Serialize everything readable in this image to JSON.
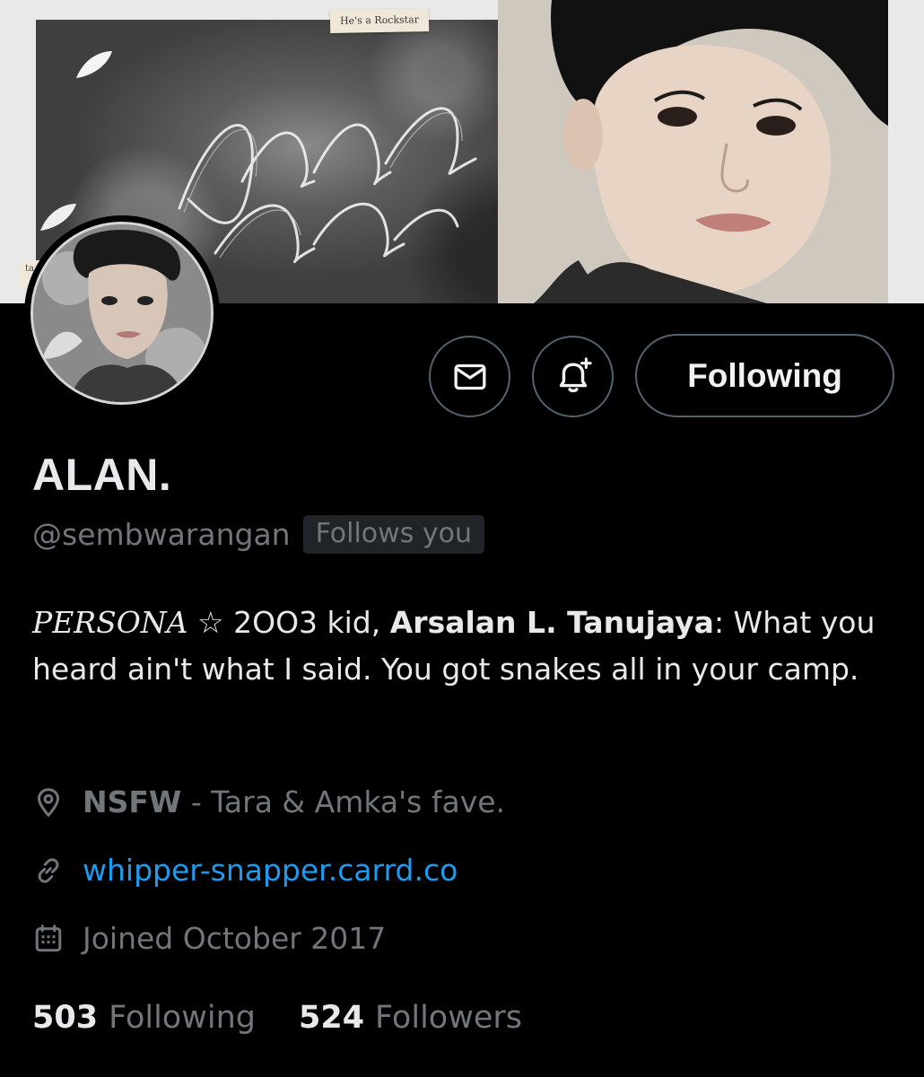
{
  "banner": {
    "tag_label": "He's a Rockstar",
    "side_tag": "ta"
  },
  "actions": {
    "message_icon": "envelope-icon",
    "notify_icon": "bell-plus-icon",
    "following_label": "Following"
  },
  "profile": {
    "display_name": "ALAN.",
    "handle": "@sembwarangan",
    "follows_you": "Follows you"
  },
  "bio": {
    "persona": "PERSONA",
    "star": "☆",
    "part1": " 2OO3 kid, ",
    "name": "Arsalan L. Tanujaya",
    "part2": ": What you heard ain't what I said. You got snakes all in your camp."
  },
  "meta": {
    "location_bold": "NSFW",
    "location_rest": " - Tara & Amka's fave.",
    "link": "whipper-snapper.carrd.co",
    "joined": "Joined October 2017"
  },
  "stats": {
    "following_count": "503",
    "following_label": "Following",
    "followers_count": "524",
    "followers_label": "Followers"
  },
  "colors": {
    "background": "#000000",
    "text_primary": "#e7e9ea",
    "text_secondary": "#71767b",
    "link": "#1d9bf0",
    "border": "#536471"
  }
}
